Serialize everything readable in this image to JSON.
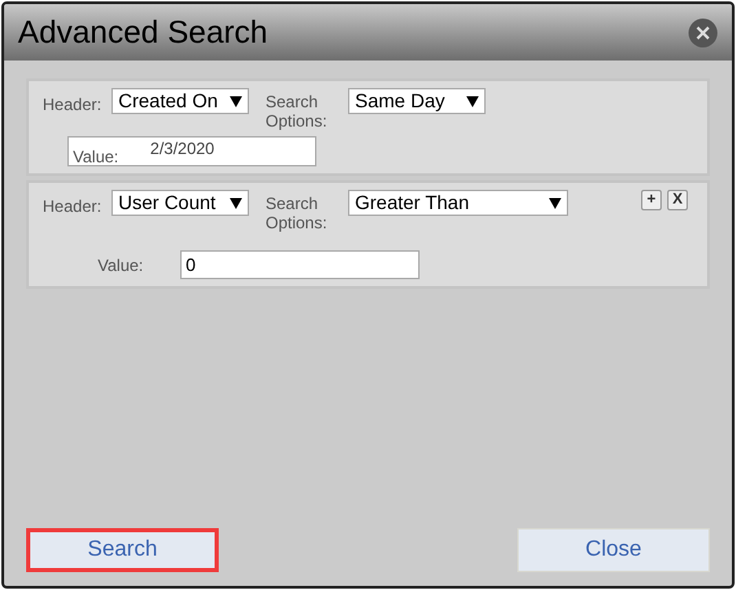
{
  "window": {
    "title": "Advanced Search"
  },
  "criteria": [
    {
      "kind": "inline",
      "header_label": "Header:",
      "header": "Created On",
      "options_label": "Search Options:",
      "option": "Same Day",
      "value_label": "Value:",
      "value": "2/3/2020"
    },
    {
      "kind": "outside",
      "header_label": "Header:",
      "header": "User Count",
      "options_label": "Search Options:",
      "option": "Greater Than",
      "value_label": "Value:",
      "value": "0",
      "actions": [
        "+",
        "X"
      ]
    }
  ],
  "buttons": [
    {
      "label": "Search",
      "focused": true
    },
    {
      "label": "Close",
      "focused": false
    }
  ]
}
